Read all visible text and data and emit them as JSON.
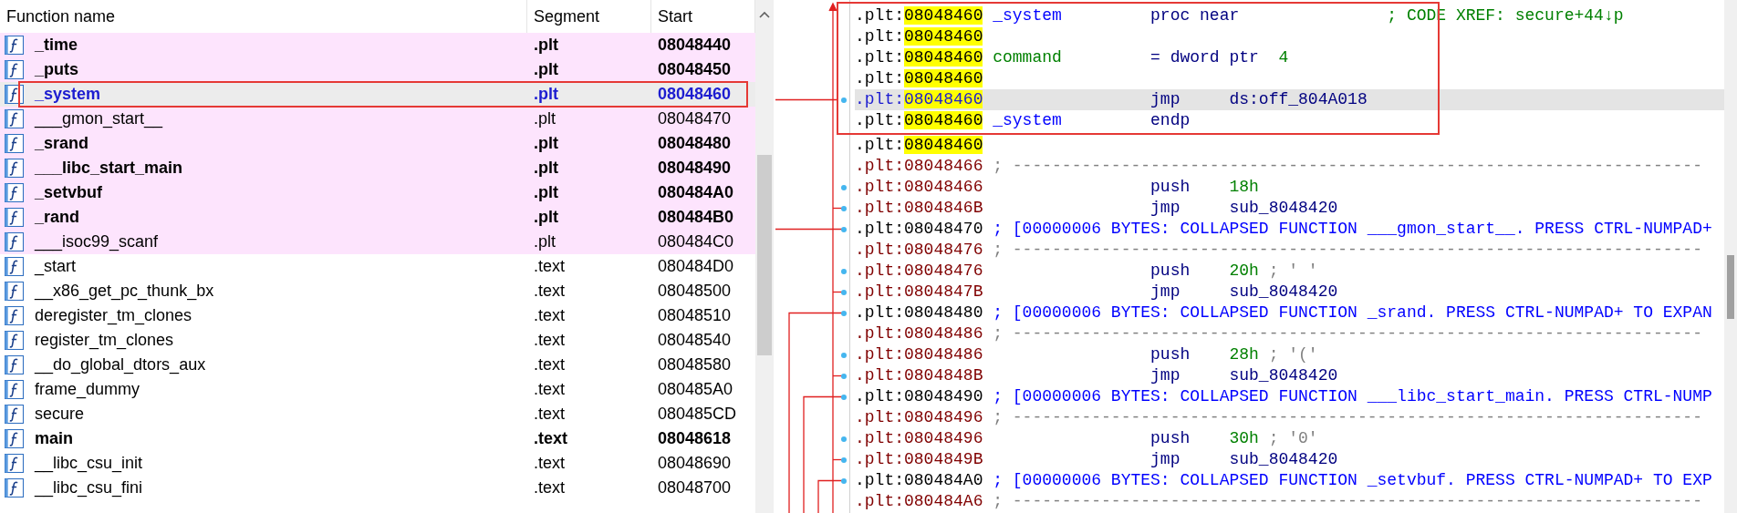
{
  "functions": {
    "columns": [
      "Function name",
      "Segment",
      "Start"
    ],
    "rows": [
      {
        "name": "_time",
        "segment": ".plt",
        "start": "08048440",
        "bold": true,
        "library": true,
        "selected": false
      },
      {
        "name": "_puts",
        "segment": ".plt",
        "start": "08048450",
        "bold": true,
        "library": true,
        "selected": false
      },
      {
        "name": "_system",
        "segment": ".plt",
        "start": "08048460",
        "bold": true,
        "library": true,
        "selected": true
      },
      {
        "name": "___gmon_start__",
        "segment": ".plt",
        "start": "08048470",
        "bold": false,
        "library": true,
        "selected": false
      },
      {
        "name": "_srand",
        "segment": ".plt",
        "start": "08048480",
        "bold": true,
        "library": true,
        "selected": false
      },
      {
        "name": "___libc_start_main",
        "segment": ".plt",
        "start": "08048490",
        "bold": true,
        "library": true,
        "selected": false
      },
      {
        "name": "_setvbuf",
        "segment": ".plt",
        "start": "080484A0",
        "bold": true,
        "library": true,
        "selected": false
      },
      {
        "name": "_rand",
        "segment": ".plt",
        "start": "080484B0",
        "bold": true,
        "library": true,
        "selected": false
      },
      {
        "name": "___isoc99_scanf",
        "segment": ".plt",
        "start": "080484C0",
        "bold": false,
        "library": true,
        "selected": false
      },
      {
        "name": "_start",
        "segment": ".text",
        "start": "080484D0",
        "bold": false,
        "library": false,
        "selected": false
      },
      {
        "name": "__x86_get_pc_thunk_bx",
        "segment": ".text",
        "start": "08048500",
        "bold": false,
        "library": false,
        "selected": false
      },
      {
        "name": "deregister_tm_clones",
        "segment": ".text",
        "start": "08048510",
        "bold": false,
        "library": false,
        "selected": false
      },
      {
        "name": "register_tm_clones",
        "segment": ".text",
        "start": "08048540",
        "bold": false,
        "library": false,
        "selected": false
      },
      {
        "name": "__do_global_dtors_aux",
        "segment": ".text",
        "start": "08048580",
        "bold": false,
        "library": false,
        "selected": false
      },
      {
        "name": "frame_dummy",
        "segment": ".text",
        "start": "080485A0",
        "bold": false,
        "library": false,
        "selected": false
      },
      {
        "name": "secure",
        "segment": ".text",
        "start": "080485CD",
        "bold": false,
        "library": false,
        "selected": false
      },
      {
        "name": "main",
        "segment": ".text",
        "start": "08048618",
        "bold": true,
        "library": false,
        "selected": false
      },
      {
        "name": "__libc_csu_init",
        "segment": ".text",
        "start": "08048690",
        "bold": false,
        "library": false,
        "selected": false
      },
      {
        "name": "__libc_csu_fini",
        "segment": ".text",
        "start": "08048700",
        "bold": false,
        "library": false,
        "selected": false
      }
    ]
  },
  "disassembly": {
    "lines": [
      {
        "segment": ".plt:",
        "address": "08048460",
        "kind": "def",
        "highlighted": true,
        "selected": false,
        "dot": false,
        "label": {
          "text": "_system",
          "kind": "function"
        },
        "mnemonic": "proc near",
        "comment": "; CODE XREF: secure+44↓p"
      },
      {
        "segment": ".plt:",
        "address": "08048460",
        "kind": "def",
        "highlighted": true,
        "selected": false,
        "dot": false
      },
      {
        "segment": ".plt:",
        "address": "08048460",
        "kind": "def",
        "highlighted": true,
        "selected": false,
        "dot": false,
        "label": {
          "text": "command",
          "kind": "variable"
        },
        "mnemonic": "= dword ptr",
        "operand": {
          "text": "4",
          "kind": "number"
        }
      },
      {
        "segment": ".plt:",
        "address": "08048460",
        "kind": "def",
        "highlighted": true,
        "selected": false,
        "dot": false
      },
      {
        "segment": ".plt:",
        "address": "08048460",
        "kind": "code",
        "highlighted": true,
        "selected": true,
        "dot": true,
        "mnemonic": "jmp",
        "operand": {
          "text": "ds:off_804A018",
          "kind": "name"
        }
      },
      {
        "segment": ".plt:",
        "address": "08048460",
        "kind": "def",
        "highlighted": true,
        "selected": false,
        "dot": false,
        "label": {
          "text": "_system",
          "kind": "function"
        },
        "mnemonic": "endp"
      },
      {
        "segment": ".plt:",
        "address": "08048460",
        "kind": "def",
        "highlighted": true,
        "selected": false,
        "dot": false
      },
      {
        "segment": ".plt:",
        "address": "08048466",
        "kind": "separator",
        "highlighted": false,
        "selected": false,
        "dot": false,
        "comment": "; ----------------------------------------------------------------------"
      },
      {
        "segment": ".plt:",
        "address": "08048466",
        "kind": "code",
        "highlighted": false,
        "selected": false,
        "dot": true,
        "mnemonic": "push",
        "operand": {
          "text": "18h",
          "kind": "number"
        }
      },
      {
        "segment": ".plt:",
        "address": "0804846B",
        "kind": "code",
        "highlighted": false,
        "selected": false,
        "dot": true,
        "mnemonic": "jmp",
        "operand": {
          "text": "sub_8048420",
          "kind": "name"
        }
      },
      {
        "segment": ".plt:",
        "address": "08048470",
        "kind": "collapsed",
        "highlighted": false,
        "selected": false,
        "dot": true,
        "comment": "; [00000006 BYTES: COLLAPSED FUNCTION ___gmon_start__. PRESS CTRL-NUMPAD+"
      },
      {
        "segment": ".plt:",
        "address": "08048476",
        "kind": "separator",
        "highlighted": false,
        "selected": false,
        "dot": false,
        "comment": "; ----------------------------------------------------------------------"
      },
      {
        "segment": ".plt:",
        "address": "08048476",
        "kind": "code",
        "highlighted": false,
        "selected": false,
        "dot": true,
        "mnemonic": "push",
        "operand": {
          "text": "20h",
          "kind": "number"
        },
        "comment": "; ' '"
      },
      {
        "segment": ".plt:",
        "address": "0804847B",
        "kind": "code",
        "highlighted": false,
        "selected": false,
        "dot": true,
        "mnemonic": "jmp",
        "operand": {
          "text": "sub_8048420",
          "kind": "name"
        }
      },
      {
        "segment": ".plt:",
        "address": "08048480",
        "kind": "collapsed",
        "highlighted": false,
        "selected": false,
        "dot": true,
        "comment": "; [00000006 BYTES: COLLAPSED FUNCTION _srand. PRESS CTRL-NUMPAD+ TO EXPAN"
      },
      {
        "segment": ".plt:",
        "address": "08048486",
        "kind": "separator",
        "highlighted": false,
        "selected": false,
        "dot": false,
        "comment": "; ----------------------------------------------------------------------"
      },
      {
        "segment": ".plt:",
        "address": "08048486",
        "kind": "code",
        "highlighted": false,
        "selected": false,
        "dot": true,
        "mnemonic": "push",
        "operand": {
          "text": "28h",
          "kind": "number"
        },
        "comment": "; '('"
      },
      {
        "segment": ".plt:",
        "address": "0804848B",
        "kind": "code",
        "highlighted": false,
        "selected": false,
        "dot": true,
        "mnemonic": "jmp",
        "operand": {
          "text": "sub_8048420",
          "kind": "name"
        }
      },
      {
        "segment": ".plt:",
        "address": "08048490",
        "kind": "collapsed",
        "highlighted": false,
        "selected": false,
        "dot": true,
        "comment": "; [00000006 BYTES: COLLAPSED FUNCTION ___libc_start_main. PRESS CTRL-NUMP"
      },
      {
        "segment": ".plt:",
        "address": "08048496",
        "kind": "separator",
        "highlighted": false,
        "selected": false,
        "dot": false,
        "comment": "; ----------------------------------------------------------------------"
      },
      {
        "segment": ".plt:",
        "address": "08048496",
        "kind": "code",
        "highlighted": false,
        "selected": false,
        "dot": true,
        "mnemonic": "push",
        "operand": {
          "text": "30h",
          "kind": "number"
        },
        "comment": "; '0'"
      },
      {
        "segment": ".plt:",
        "address": "0804849B",
        "kind": "code",
        "highlighted": false,
        "selected": false,
        "dot": true,
        "mnemonic": "jmp",
        "operand": {
          "text": "sub_8048420",
          "kind": "name"
        }
      },
      {
        "segment": ".plt:",
        "address": "080484A0",
        "kind": "collapsed",
        "highlighted": false,
        "selected": false,
        "dot": true,
        "comment": "; [00000006 BYTES: COLLAPSED FUNCTION _setvbuf. PRESS CTRL-NUMPAD+ TO EXP"
      },
      {
        "segment": ".plt:",
        "address": "080484A6",
        "kind": "separator",
        "highlighted": false,
        "selected": false,
        "dot": false,
        "comment": "; ----------------------------------------------------------------------"
      }
    ]
  }
}
